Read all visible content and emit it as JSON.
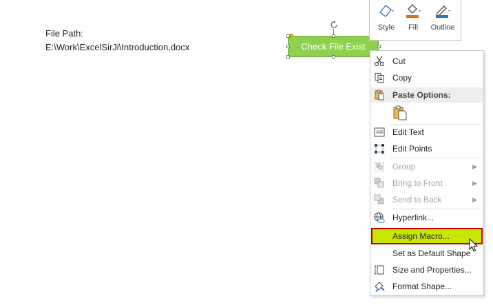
{
  "sheet": {
    "path_label": "File Path:",
    "path_value": "E:\\Work\\ExcelSirJi\\Introduction.docx"
  },
  "shape": {
    "label": "Check File Exist",
    "fill_color": "#8fd14f"
  },
  "mini_toolbar": {
    "style": "Style",
    "fill": "Fill",
    "outline": "Outline"
  },
  "context_menu": {
    "items": [
      {
        "label": "Cut",
        "icon": "scissors-icon",
        "enabled": true
      },
      {
        "label": "Copy",
        "icon": "copy-icon",
        "enabled": true
      },
      {
        "label": "Paste Options:",
        "icon": "paste-icon",
        "enabled": true
      },
      {
        "label": "Edit Text",
        "icon": "edit-text-icon",
        "enabled": true
      },
      {
        "label": "Edit Points",
        "icon": "edit-points-icon",
        "enabled": true
      },
      {
        "label": "Group",
        "icon": "group-icon",
        "enabled": false
      },
      {
        "label": "Bring to Front",
        "icon": "bring-front-icon",
        "enabled": false
      },
      {
        "label": "Send to Back",
        "icon": "send-back-icon",
        "enabled": false
      },
      {
        "label": "Hyperlink...",
        "icon": "hyperlink-icon",
        "enabled": true
      },
      {
        "label": "Assign Macro...",
        "icon": "",
        "enabled": true,
        "highlighted": true
      },
      {
        "label": "Set as Default Shape",
        "icon": "",
        "enabled": true
      },
      {
        "label": "Size and Properties...",
        "icon": "size-properties-icon",
        "enabled": true
      },
      {
        "label": "Format Shape...",
        "icon": "format-shape-icon",
        "enabled": true
      }
    ],
    "highlight_color": "#c8e600"
  }
}
